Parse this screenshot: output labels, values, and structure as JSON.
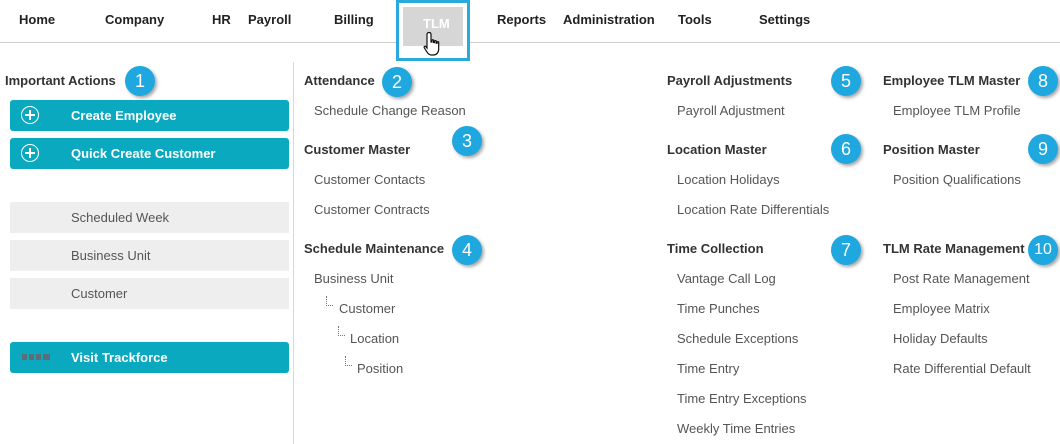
{
  "nav": {
    "items": [
      "Home",
      "Company",
      "HR",
      "Payroll",
      "Billing",
      "TLM",
      "Reports",
      "Administration",
      "Tools",
      "Settings"
    ],
    "active": "TLM"
  },
  "sidebar": {
    "title": "Important Actions",
    "buttons": {
      "create_employee": "Create Employee",
      "quick_create_customer": "Quick Create Customer",
      "visit_trackforce": "Visit Trackforce"
    },
    "shortcuts": [
      "Scheduled Week",
      "Business Unit",
      "Customer"
    ]
  },
  "badges": [
    "1",
    "2",
    "3",
    "4",
    "5",
    "6",
    "7",
    "8",
    "9",
    "10"
  ],
  "sections": {
    "attendance": {
      "title": "Attendance",
      "links": [
        "Schedule Change Reason"
      ]
    },
    "customer_master": {
      "title": "Customer Master",
      "links": [
        "Customer Contacts",
        "Customer Contracts"
      ]
    },
    "schedule_maintenance": {
      "title": "Schedule Maintenance",
      "links": [
        "Business Unit",
        "Customer",
        "Location",
        "Position"
      ]
    },
    "payroll_adjustments": {
      "title": "Payroll Adjustments",
      "links": [
        "Payroll Adjustment"
      ]
    },
    "location_master": {
      "title": "Location Master",
      "links": [
        "Location Holidays",
        "Location Rate Differentials"
      ]
    },
    "time_collection": {
      "title": "Time Collection",
      "links": [
        "Vantage Call Log",
        "Time Punches",
        "Schedule Exceptions",
        "Time Entry",
        "Time Entry Exceptions",
        "Weekly Time Entries"
      ]
    },
    "employee_tlm_master": {
      "title": "Employee TLM Master",
      "links": [
        "Employee TLM Profile"
      ]
    },
    "position_master": {
      "title": "Position Master",
      "links": [
        "Position Qualifications"
      ]
    },
    "tlm_rate_management": {
      "title": "TLM Rate Management",
      "links": [
        "Post Rate Management",
        "Employee Matrix",
        "Holiday Defaults",
        "Rate Differential Default"
      ]
    }
  },
  "colors": {
    "accent_teal": "#0ba9bf",
    "badge_blue": "#1fa7e0",
    "active_border": "#29a9dc"
  }
}
